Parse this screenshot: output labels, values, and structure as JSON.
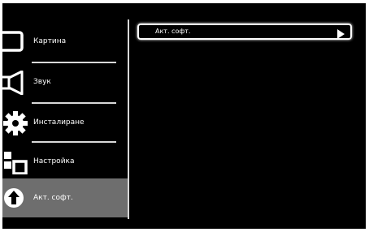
{
  "menu": {
    "items": [
      {
        "label": "Картина",
        "icon": "picture-icon"
      },
      {
        "label": "Звук",
        "icon": "speaker-icon"
      },
      {
        "label": "Инсталиране",
        "icon": "gear-icon"
      },
      {
        "label": "Настройка",
        "icon": "blocks-icon"
      },
      {
        "label": "Акт. софт.",
        "icon": "update-arrow-icon",
        "selected": true
      }
    ]
  },
  "submenu": {
    "items": [
      {
        "label": "Акт. софт.",
        "icon": "play-arrow-icon"
      }
    ]
  },
  "colors": {
    "background": "#000000",
    "selected": "#6e6e6e",
    "divider": "#d8d8d8",
    "text": "#ffffff"
  }
}
